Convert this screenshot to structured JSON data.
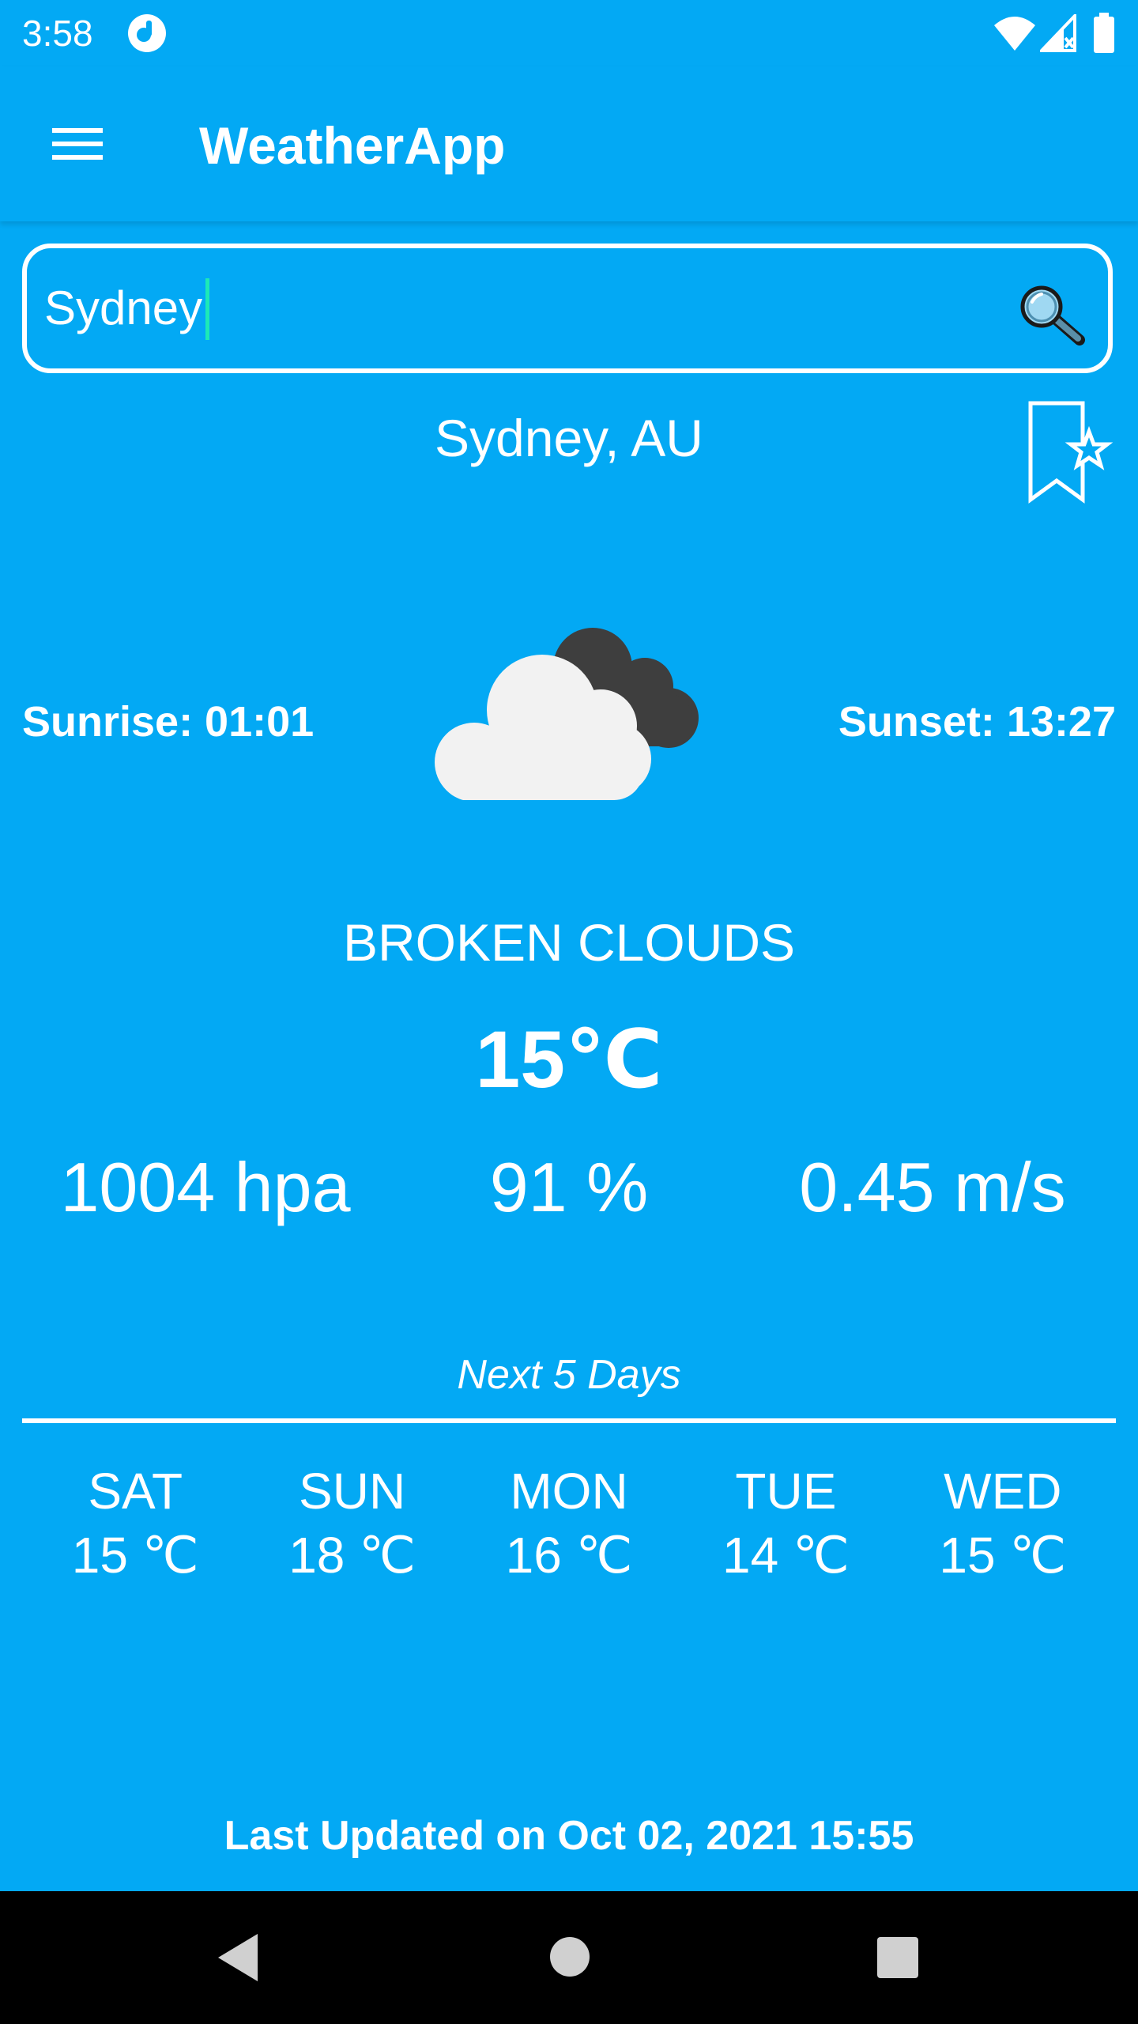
{
  "status_bar": {
    "time": "3:58",
    "icons": [
      "app-notification-icon",
      "wifi-icon",
      "signal-icon",
      "battery-icon"
    ]
  },
  "app_bar": {
    "title": "WeatherApp",
    "menu_icon": "hamburger-menu-icon"
  },
  "search": {
    "value": "Sydney",
    "icon": "search-icon"
  },
  "location": {
    "name": "Sydney, AU",
    "bookmark_icon": "bookmark-star-icon"
  },
  "current": {
    "sunrise": "Sunrise: 01:01",
    "sunset": "Sunset: 13:27",
    "weather_icon": "broken-clouds-icon",
    "condition": "BROKEN CLOUDS",
    "temperature": "15℃",
    "pressure": "1004 hpa",
    "humidity": "91 %",
    "wind": "0.45 m/s"
  },
  "forecast": {
    "title": "Next 5 Days",
    "days": [
      {
        "day": "SAT",
        "temp": "15 ℃"
      },
      {
        "day": "SUN",
        "temp": "18 ℃"
      },
      {
        "day": "MON",
        "temp": "16 ℃"
      },
      {
        "day": "TUE",
        "temp": "14 ℃"
      },
      {
        "day": "WED",
        "temp": "15 ℃"
      }
    ]
  },
  "last_updated": "Last Updated on Oct 02, 2021 15:55",
  "colors": {
    "background": "#03A9F4",
    "text": "#FFFFFF",
    "cursor": "#1DE9B6",
    "cloud_light": "#F2F2F2",
    "cloud_dark": "#3E3E3E",
    "nav_bar": "#000000"
  },
  "nav_bar": {
    "icons": [
      "back-icon",
      "home-icon",
      "recents-icon"
    ]
  }
}
